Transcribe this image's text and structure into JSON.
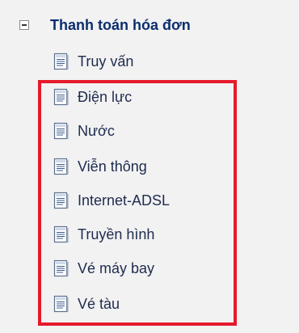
{
  "tree": {
    "parent": {
      "label": "Thanh toán hóa đơn",
      "expanded": true
    },
    "items": [
      {
        "label": "Truy vấn",
        "icon": "document-icon"
      },
      {
        "label": "Điện lực",
        "icon": "document-icon"
      },
      {
        "label": "Nước",
        "icon": "document-icon"
      },
      {
        "label": "Viễn thông",
        "icon": "document-icon"
      },
      {
        "label": "Internet-ADSL",
        "icon": "document-icon"
      },
      {
        "label": "Truyền hình",
        "icon": "document-icon"
      },
      {
        "label": "Vé máy bay",
        "icon": "document-icon"
      },
      {
        "label": "Vé tàu",
        "icon": "document-icon"
      }
    ]
  },
  "highlight": {
    "color": "#e6192b"
  }
}
